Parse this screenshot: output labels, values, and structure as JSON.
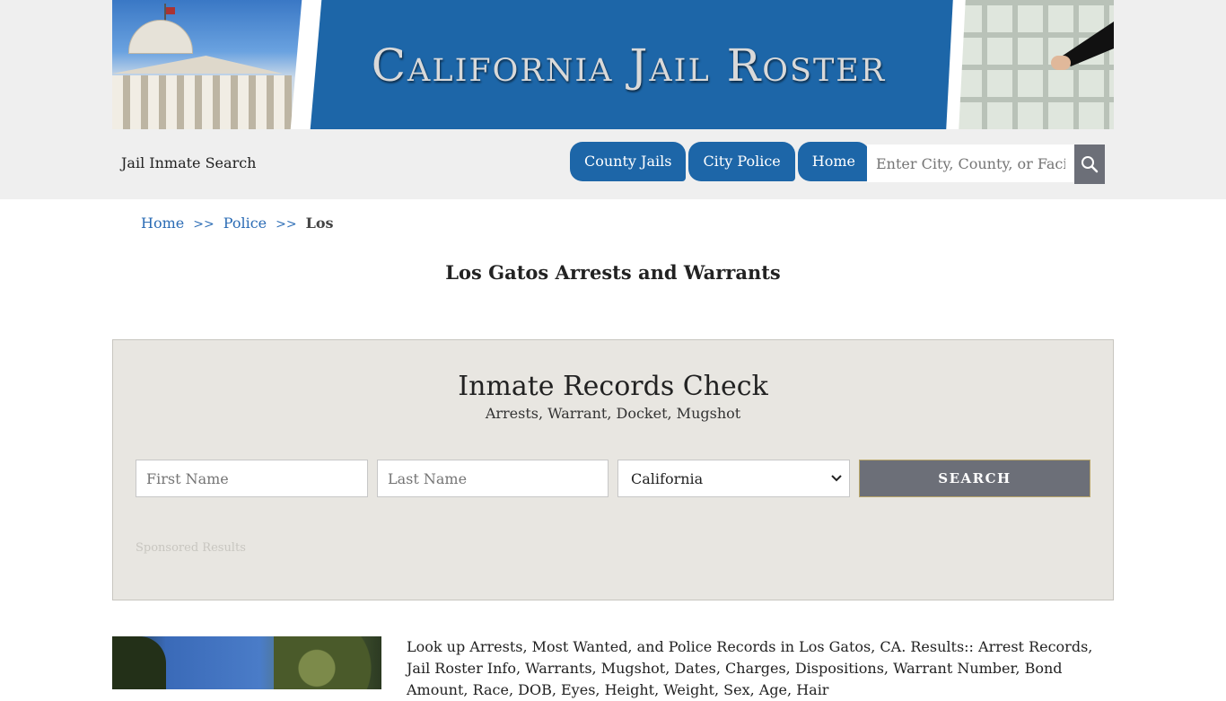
{
  "header": {
    "banner_title": "California Jail Roster",
    "site_name": "Jail Inmate Search",
    "nav": [
      "County Jails",
      "City Police",
      "Home"
    ],
    "search_placeholder": "Enter City, County, or Facility"
  },
  "breadcrumb": {
    "items": [
      "Home",
      "Police"
    ],
    "separator": ">>",
    "current": "Los"
  },
  "page_title": "Los Gatos Arrests and Warrants",
  "records": {
    "heading": "Inmate Records Check",
    "subheading": "Arrests, Warrant, Docket, Mugshot",
    "first_name_placeholder": "First Name",
    "last_name_placeholder": "Last Name",
    "state_selected": "California",
    "search_label": "SEARCH",
    "sponsored": "Sponsored Results"
  },
  "description": "Look up Arrests, Most Wanted, and Police Records in Los Gatos, CA. Results:: Arrest Records, Jail Roster Info, Warrants, Mugshot, Dates, Charges, Dispositions, Warrant Number, Bond Amount, Race, DOB, Eyes, Height, Weight, Sex, Age, Hair"
}
